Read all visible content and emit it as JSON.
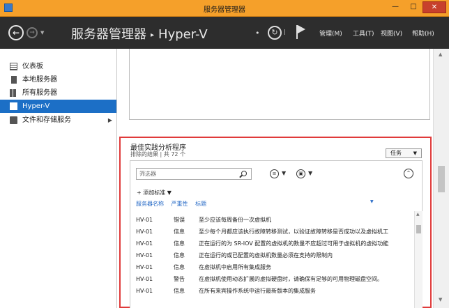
{
  "window": {
    "title": "服务器管理器",
    "minimize": "—",
    "maximize": "□",
    "close": "✕"
  },
  "navbar": {
    "breadcrumb_root": "服务器管理器",
    "breadcrumb_current": "Hyper-V",
    "menus": [
      "管理(M)",
      "工具(T)",
      "视图(V)",
      "帮助(H)"
    ]
  },
  "sidebar": {
    "items": [
      {
        "label": "仪表板",
        "icon": "dashboard-icon"
      },
      {
        "label": "本地服务器",
        "icon": "local-server-icon"
      },
      {
        "label": "所有服务器",
        "icon": "all-servers-icon"
      },
      {
        "label": "Hyper-V",
        "icon": "hyper-v-icon",
        "active": true
      },
      {
        "label": "文件和存储服务",
        "icon": "file-storage-icon",
        "expandable": true
      }
    ]
  },
  "bpa": {
    "title": "最佳实践分析程序",
    "subtitle": "排除的结果 | 共 72 个",
    "tasks_label": "任务",
    "filter_placeholder": "筛选器",
    "add_criteria": "添加标准",
    "columns": [
      "服务器名称",
      "严重性",
      "标题"
    ],
    "rows": [
      {
        "server": "HV-01",
        "severity": "错误",
        "title": "至少应该每周备份一次虚拟机"
      },
      {
        "server": "HV-01",
        "severity": "信息",
        "title": "至少每个月都应该执行故障转移测试，以验证故障转移是否成功以及虚拟机工"
      },
      {
        "server": "HV-01",
        "severity": "信息",
        "title": "正在运行的为 SR-IOV 配置的虚拟机的数量不应超过可用于虚拟机的虚拟功能"
      },
      {
        "server": "HV-01",
        "severity": "信息",
        "title": "正在运行的或已配置的虚拟机数量必须在支持的限制内"
      },
      {
        "server": "HV-01",
        "severity": "信息",
        "title": "在虚拟机中启用所有集成服务"
      },
      {
        "server": "HV-01",
        "severity": "警告",
        "title": "在虚拟机使用动态扩展的虚拟硬盘时，请确保有足够的可用物理磁盘空间。"
      },
      {
        "server": "HV-01",
        "severity": "信息",
        "title": "在所有来宾操作系统中运行最新版本的集成服务"
      }
    ]
  }
}
